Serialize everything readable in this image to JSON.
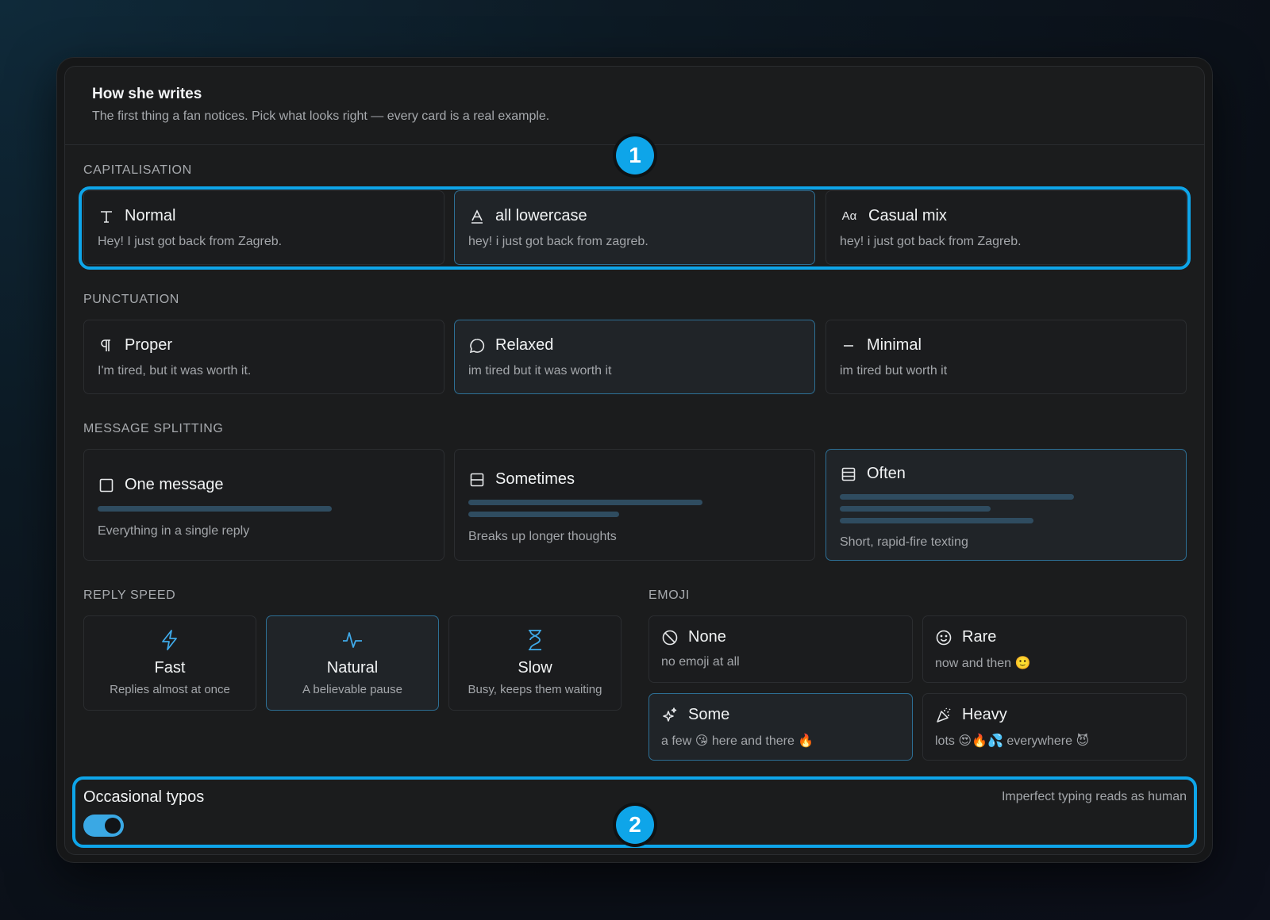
{
  "header": {
    "title": "How she writes",
    "subtitle": "The first thing a fan notices. Pick what looks right — every card is a real example."
  },
  "sections": {
    "capitalisation": {
      "label": "CAPITALISATION",
      "selected": "all lowercase",
      "options": [
        {
          "icon": "text-type-icon",
          "title": "Normal",
          "example": "Hey! I just got back from Zagreb."
        },
        {
          "icon": "lowercase-a-icon",
          "title": "all lowercase",
          "example": "hey! i just got back from zagreb."
        },
        {
          "icon": "case-aa-icon",
          "glyph": "Aα",
          "title": "Casual mix",
          "example": "hey! i just got back from Zagreb."
        }
      ]
    },
    "punctuation": {
      "label": "PUNCTUATION",
      "selected": "Relaxed",
      "options": [
        {
          "icon": "pilcrow-icon",
          "title": "Proper",
          "example": "I'm tired, but it was worth it."
        },
        {
          "icon": "speech-bubble-icon",
          "title": "Relaxed",
          "example": "im tired but it was worth it"
        },
        {
          "icon": "dash-icon",
          "title": "Minimal",
          "example": "im tired but worth it"
        }
      ]
    },
    "splitting": {
      "label": "MESSAGE SPLITTING",
      "selected": "Often",
      "options": [
        {
          "icon": "single-square-icon",
          "title": "One message",
          "desc": "Everything in a single reply"
        },
        {
          "icon": "split-square-icon",
          "title": "Sometimes",
          "desc": "Breaks up longer thoughts"
        },
        {
          "icon": "triple-split-square-icon",
          "title": "Often",
          "desc": "Short, rapid-fire texting"
        }
      ]
    },
    "reply_speed": {
      "label": "REPLY SPEED",
      "selected": "Natural",
      "options": [
        {
          "icon": "lightning-icon",
          "title": "Fast",
          "desc": "Replies almost at once"
        },
        {
          "icon": "activity-pulse-icon",
          "title": "Natural",
          "desc": "A believable pause"
        },
        {
          "icon": "hourglass-icon",
          "title": "Slow",
          "desc": "Busy, keeps them waiting"
        }
      ]
    },
    "emoji": {
      "label": "EMOJI",
      "selected": "Some",
      "options": [
        {
          "icon": "no-symbol-icon",
          "title": "None",
          "desc": "no emoji at all"
        },
        {
          "icon": "smiley-icon",
          "title": "Rare",
          "desc": "now and then 🙂"
        },
        {
          "icon": "sparkles-icon",
          "title": "Some",
          "desc": "a few 😘 here and there 🔥"
        },
        {
          "icon": "party-popper-icon",
          "title": "Heavy",
          "desc": "lots 😍🔥💦 everywhere 😈"
        }
      ]
    }
  },
  "typos": {
    "label": "Occasional typos",
    "hint": "Imperfect typing reads as human",
    "enabled": true
  },
  "annotations": {
    "badge_1": "1",
    "badge_2": "2"
  },
  "colors": {
    "accent": "#0ea5e9",
    "selected_border": "#2d6f95",
    "icon_accent": "#3fa9e8",
    "bar": "#2f4c60"
  }
}
